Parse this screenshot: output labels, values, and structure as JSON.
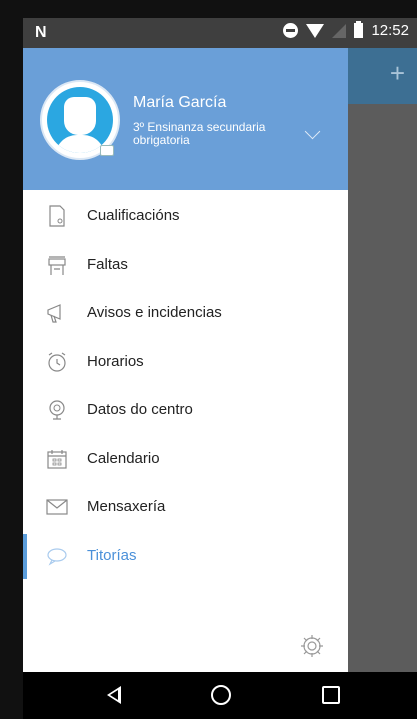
{
  "status_bar": {
    "left_icon": "N",
    "time": "12:52"
  },
  "app_toolbar": {
    "action_icon": "+"
  },
  "drawer": {
    "header": {
      "user_name": "María García",
      "course": "3º Ensinanza secundaria obrigatoria"
    },
    "items": [
      {
        "label": "Cualificacións",
        "icon": "document-icon",
        "active": false
      },
      {
        "label": "Faltas",
        "icon": "desk-icon",
        "active": false
      },
      {
        "label": "Avisos e incidencias",
        "icon": "megaphone-icon",
        "active": false
      },
      {
        "label": "Horarios",
        "icon": "alarm-clock-icon",
        "active": false
      },
      {
        "label": "Datos do centro",
        "icon": "school-bell-icon",
        "active": false
      },
      {
        "label": "Calendario",
        "icon": "calendar-icon",
        "active": false
      },
      {
        "label": "Mensaxería",
        "icon": "envelope-icon",
        "active": false
      },
      {
        "label": "Titorías",
        "icon": "speech-bubble-icon",
        "active": true
      }
    ]
  },
  "colors": {
    "header_bg": "#6a9fd8",
    "active_text": "#4a90d9",
    "icon_gray": "#888888"
  }
}
